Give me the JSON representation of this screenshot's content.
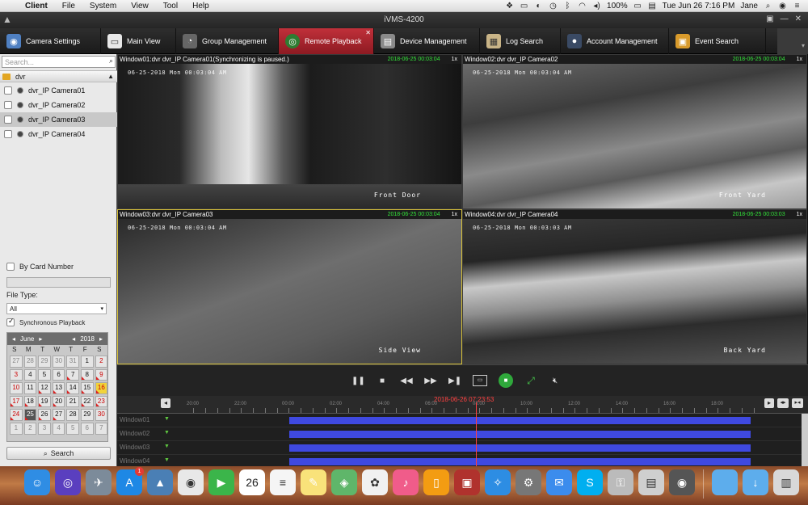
{
  "menubar": {
    "app": "Client",
    "items": [
      "File",
      "System",
      "View",
      "Tool",
      "Help"
    ],
    "battery": "100%",
    "datetime": "Tue Jun 26  7:16 PM",
    "user": "Jane"
  },
  "window": {
    "title": "iVMS-4200"
  },
  "toolbar": {
    "items": [
      {
        "label": "Camera Settings",
        "icon": "camera-settings-icon"
      },
      {
        "label": "Main View",
        "icon": "monitor-icon"
      },
      {
        "label": "Group Management",
        "icon": "group-icon"
      },
      {
        "label": "Remote Playback",
        "icon": "playback-icon"
      },
      {
        "label": "Device Management",
        "icon": "device-icon"
      },
      {
        "label": "Log Search",
        "icon": "log-icon"
      },
      {
        "label": "Account Management",
        "icon": "account-icon"
      },
      {
        "label": "Event Search",
        "icon": "event-icon"
      }
    ],
    "active_index": 3
  },
  "left": {
    "search_placeholder": "Search...",
    "group": "dvr",
    "cameras": [
      "dvr_IP Camera01",
      "dvr_IP Camera02",
      "dvr_IP Camera03",
      "dvr_IP Camera04"
    ],
    "selected_camera": 2,
    "by_card_label": "By Card Number",
    "file_type_label": "File Type:",
    "file_type_value": "All",
    "sync_label": "Synchronous Playback",
    "calendar": {
      "month": "June",
      "year": "2018",
      "dow": [
        "S",
        "M",
        "T",
        "W",
        "T",
        "F",
        "S"
      ],
      "days": [
        "27",
        "28",
        "29",
        "30",
        "31",
        "1",
        "2",
        "3",
        "4",
        "5",
        "6",
        "7",
        "8",
        "9",
        "10",
        "11",
        "12",
        "13",
        "14",
        "15",
        "16",
        "17",
        "18",
        "19",
        "20",
        "21",
        "22",
        "23",
        "24",
        "25",
        "26",
        "27",
        "28",
        "29",
        "30",
        "1",
        "2",
        "3",
        "4",
        "5",
        "6",
        "7"
      ]
    },
    "search_button": "Search"
  },
  "windows": [
    {
      "title": "Window01:dvr dvr_IP Camera01(Synchronizing is paused.)",
      "timestamp": "2018-06-25 00:03:04",
      "speed": "1x",
      "osd_date": "06-25-2018 Mon 00:03:04 AM",
      "osd_name": "Front Door"
    },
    {
      "title": "Window02:dvr dvr_IP Camera02",
      "timestamp": "2018-06-25 00:03:04",
      "speed": "1x",
      "osd_date": "06-25-2018 Mon 00:03:04 AM",
      "osd_name": "Front Yard"
    },
    {
      "title": "Window03:dvr dvr_IP Camera03",
      "timestamp": "2018-06-25 00:03:04",
      "speed": "1x",
      "osd_date": "06-25-2018 Mon 00:03:04 AM",
      "osd_name": "Side View"
    },
    {
      "title": "Window04:dvr dvr_IP Camera04",
      "timestamp": "2018-06-25 00:03:03",
      "speed": "1x",
      "osd_date": "06-25-2018 Mon 00:03:03 AM",
      "osd_name": "Back Yard"
    }
  ],
  "timeline": {
    "current": "2018-06-26 07:23:53",
    "ticks": [
      "20:00",
      "22:00",
      "00:00",
      "02:00",
      "04:00",
      "06:00",
      "08:00",
      "10:00",
      "12:00",
      "14:00",
      "16:00",
      "18:00"
    ],
    "rows": [
      "Window01",
      "Window02",
      "Window03",
      "Window04"
    ]
  },
  "dock": {
    "apps": [
      "finder",
      "siri",
      "launchpad",
      "app-store",
      "preview",
      "chrome",
      "facetime",
      "calendar",
      "reminders",
      "notes",
      "maps",
      "photos",
      "itunes",
      "books",
      "photo-booth",
      "safari",
      "system-preferences",
      "messages",
      "skype",
      "keychain",
      "ivms",
      "image-capture",
      "folder",
      "downloads",
      "trash"
    ],
    "calendar_day": "26",
    "appstore_badge": "1"
  }
}
